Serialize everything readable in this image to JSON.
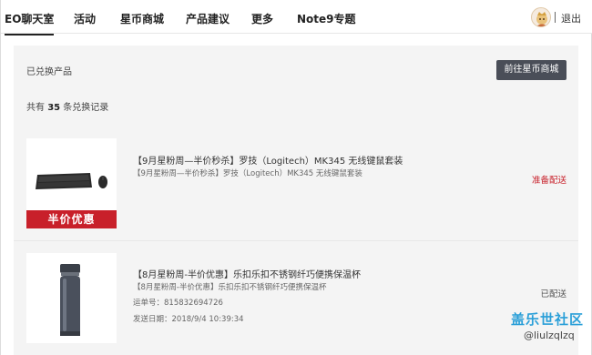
{
  "nav": {
    "tabs": [
      {
        "label": "EO聊天室",
        "active": true
      },
      {
        "label": "活动",
        "active": false
      },
      {
        "label": "星币商城",
        "active": false
      },
      {
        "label": "产品建议",
        "active": false
      },
      {
        "label": "更多",
        "active": false
      },
      {
        "label": "Note9专题",
        "active": false
      }
    ],
    "logout": "退出",
    "separator": "|"
  },
  "panel": {
    "redeemed_label": "已兑换产品",
    "store_button": "前往星币商城",
    "count_prefix": "共有",
    "count_value": "35",
    "count_suffix": "条兑换记录"
  },
  "orders": [
    {
      "title": "【9月星粉周—半价秒杀】罗技（Logitech）MK345 无线键鼠套装",
      "subtitle": "【9月星粉周—半价秒杀】罗技（Logitech）MK345 无线键鼠套装",
      "status": "准备配送",
      "banner": "半价优惠",
      "icon": "keyboard-mouse-image"
    },
    {
      "title": "【8月星粉周-半价优惠】乐扣乐扣不锈钢纤巧便携保温杯",
      "subtitle": "【8月星粉周-半价优惠】乐扣乐扣不锈钢纤巧便携保温杯",
      "tracking": "运单号：815832694726",
      "ship_date": "发送日期：2018/9/4 10:39:34",
      "status": "已配送",
      "icon": "thermos-image"
    }
  ],
  "watermark": {
    "logo": "盖乐世社区",
    "handle": "@liulzqlzq"
  },
  "colors": {
    "accent_red": "#c8202a",
    "button_dark": "#4a4e58",
    "watermark_blue": "#2a9fd8",
    "panel_bg": "#f4f4f4"
  }
}
